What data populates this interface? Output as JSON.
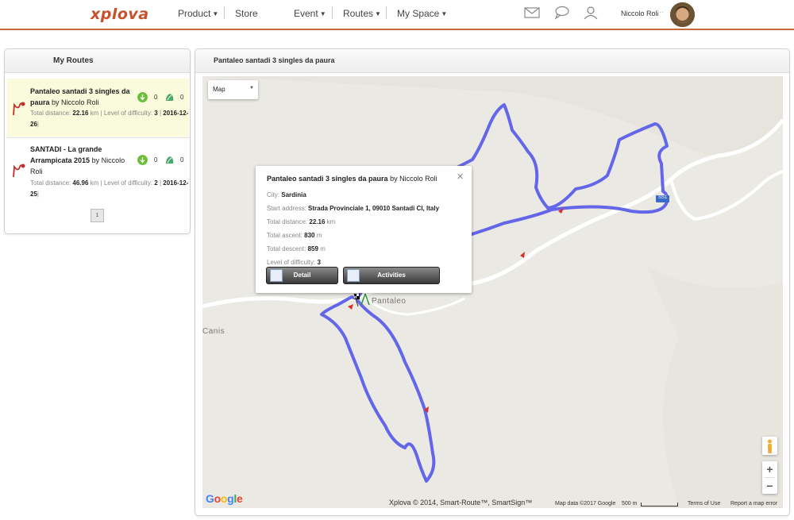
{
  "brand": {
    "logo": "xplova",
    "accent": "#c9663a"
  },
  "nav": {
    "product": "Product",
    "store": "Store",
    "event": "Event",
    "routes": "Routes",
    "my_space": "My Space"
  },
  "user": {
    "name": "Niccolo Roli",
    "dots": "···"
  },
  "left_panel": {
    "title": "My Routes",
    "routes": [
      {
        "title": "Pantaleo santadi 3 singles da paura",
        "by": "by Niccolo Roli",
        "distance_label": "Total distance:",
        "distance": "22.16",
        "unit": "km",
        "difficulty_label": "Level of difficulty:",
        "difficulty": "3",
        "date": "2016-12-26",
        "downloads": "0",
        "likes": "0"
      },
      {
        "title": "SANTADI - La grande Arrampicata 2015",
        "by": "by Niccolo Roli",
        "distance_label": "Total distance:",
        "distance": "46.96",
        "unit": "km",
        "difficulty_label": "Level of difficulty:",
        "difficulty": "2",
        "date": "2016-12-25",
        "downloads": "0",
        "likes": "0"
      }
    ],
    "page": "1"
  },
  "map_panel": {
    "title": "Pantaleo santadi 3 singles da paura",
    "map_type": "Map",
    "labels": {
      "pantaleo": "Pantaleo",
      "canis": "Canis",
      "road": "SS1"
    },
    "zoom_in": "+",
    "zoom_out": "−",
    "google": {
      "g1": "G",
      "o1": "o",
      "o2": "o",
      "g2": "g",
      "l": "l",
      "e": "e"
    },
    "copyright": "Xplova © 2014, Smart-Route™, SmartSign™",
    "map_data": "Map data ©2017 Google",
    "scale": "500 m",
    "terms": "Terms of Use",
    "report": "Report a map error"
  },
  "info_window": {
    "title": "Pantaleo santadi 3 singles da paura",
    "by": "by Niccolo Roli",
    "close": "✕",
    "rows": [
      {
        "label": "City:",
        "value": "Sardinia",
        "unit": ""
      },
      {
        "label": "Start address:",
        "value": "Strada Provinciale 1, 09010 Santadi CI, Italy",
        "unit": ""
      },
      {
        "label": "Total distance:",
        "value": "22.16",
        "unit": "km"
      },
      {
        "label": "Total ascent:",
        "value": "830",
        "unit": "m"
      },
      {
        "label": "Total descent:",
        "value": "859",
        "unit": "m"
      },
      {
        "label": "Level of difficulty:",
        "value": "3",
        "unit": ""
      }
    ],
    "detail_button": "Detail",
    "activities_button": "Activities"
  },
  "colors": {
    "route": "#6366e8",
    "road": "#ffffff",
    "map_bg": "#ebe9e3"
  }
}
